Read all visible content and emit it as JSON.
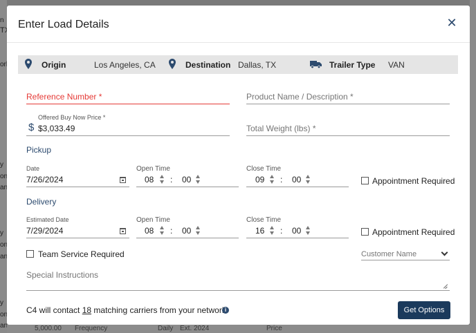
{
  "modal": {
    "title": "Enter Load Details",
    "close_glyph": "✕"
  },
  "shipment": {
    "origin_label": "Origin",
    "origin_value": "Los Angeles, CA",
    "destination_label": "Destination",
    "destination_value": "Dallas, TX",
    "trailer_label": "Trailer Type",
    "trailer_value": "VAN"
  },
  "form": {
    "reference_placeholder": "Reference Number *",
    "product_placeholder": "Product Name / Description *",
    "price_label": "Offered Buy Now Price *",
    "price_symbol": "$",
    "price_value": "$3,033.49",
    "weight_placeholder": "Total Weight (lbs) *"
  },
  "pickup": {
    "section_title": "Pickup",
    "date_label": "Date",
    "date_value": "7/26/2024",
    "open_label": "Open Time",
    "open_hour": "08",
    "open_minute": "00",
    "close_label": "Close Time",
    "close_hour": "09",
    "close_minute": "00",
    "appointment_label": "Appointment Required"
  },
  "delivery": {
    "section_title": "Delivery",
    "date_label": "Estimated Date",
    "date_value": "7/29/2024",
    "open_label": "Open Time",
    "open_hour": "08",
    "open_minute": "00",
    "close_label": "Close Time",
    "close_hour": "16",
    "close_minute": "00",
    "appointment_label": "Appointment Required"
  },
  "extras": {
    "team_service_label": "Team Service Required",
    "customer_placeholder": "Customer Name",
    "instructions_placeholder": "Special Instructions"
  },
  "footer": {
    "contact_prefix": "C4 will contact",
    "carrier_count": "18",
    "contact_suffix": "matching carriers from your network",
    "get_options_label": "Get Options"
  },
  "background": {
    "left_fragments": [
      "n",
      "TX",
      "orla",
      "y",
      "ont",
      "an",
      "y",
      "ont",
      "an",
      "y",
      "ont",
      "an"
    ],
    "bottom_fragments": [
      "5,000.00",
      "Frequency",
      "Daily",
      "Ext. 2024",
      "Price"
    ]
  },
  "colors": {
    "accent": "#2c4a6e",
    "button": "#1b3a5c",
    "error": "#e53935",
    "bar": "#e5e5e5"
  }
}
